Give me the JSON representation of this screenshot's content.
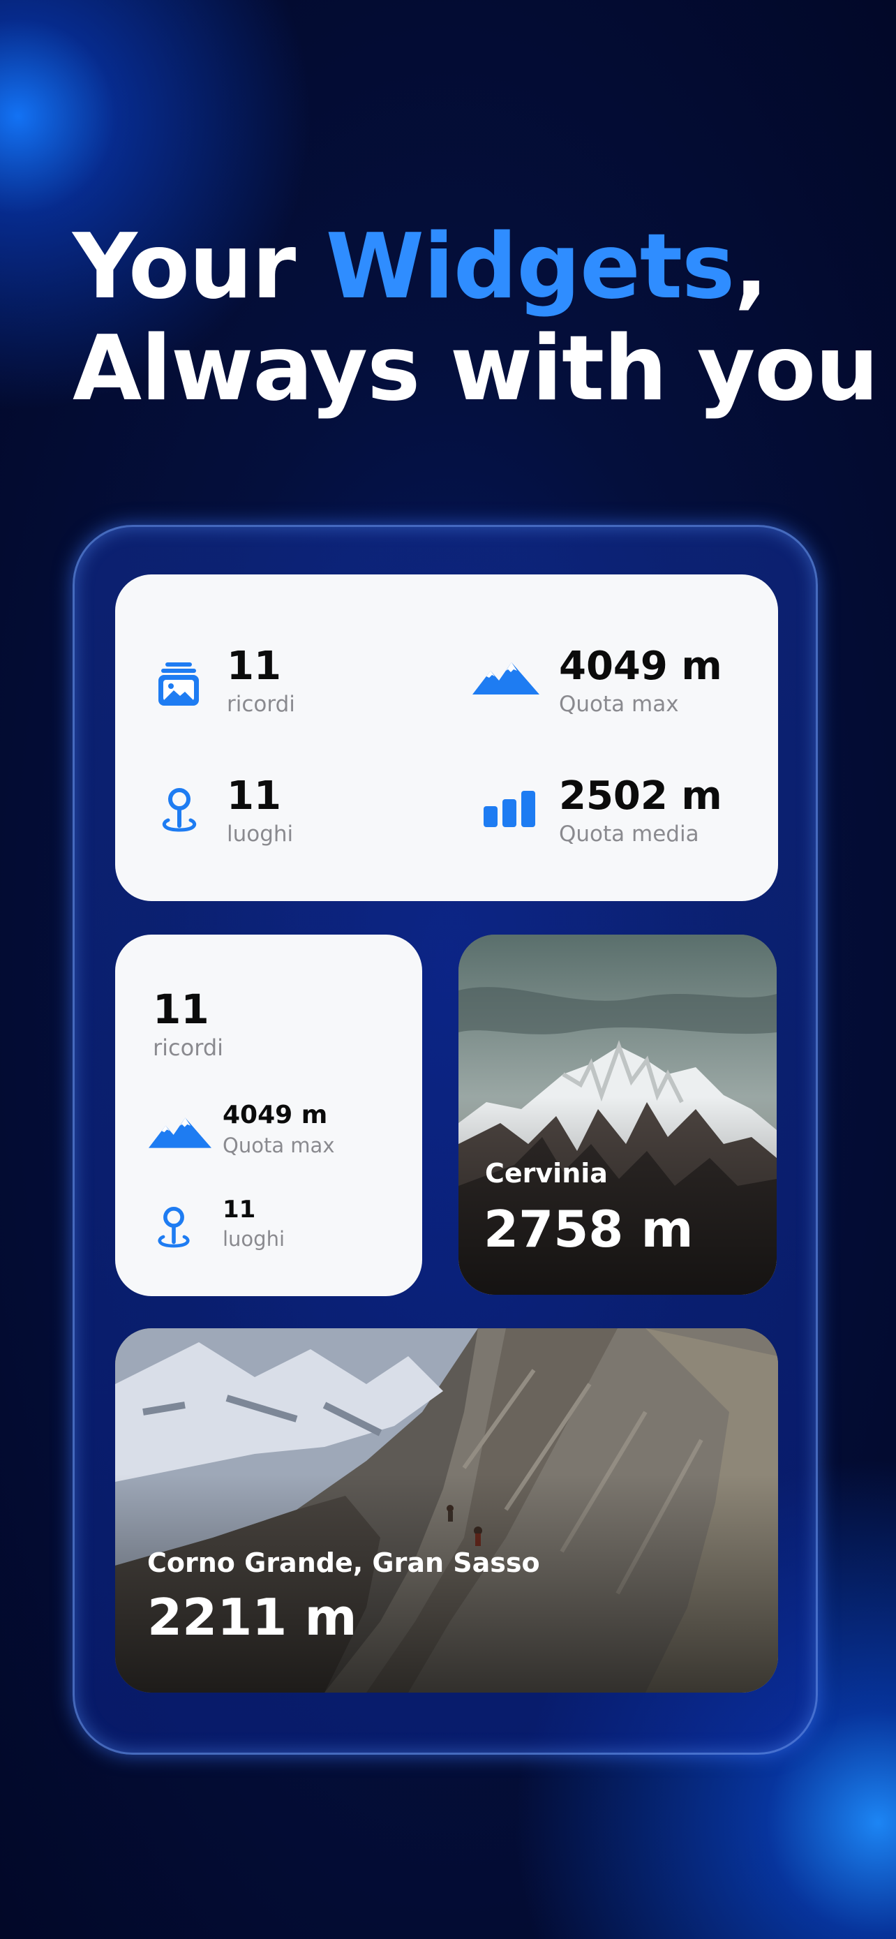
{
  "headline": {
    "line1_pre": "Your ",
    "line1_accent": "Widgets",
    "line1_post": ",",
    "line2": "Always with you"
  },
  "widget_large": {
    "memories": {
      "value": "11",
      "label": "ricordi",
      "icon": "photo-stack-icon"
    },
    "places": {
      "value": "11",
      "label": "luoghi",
      "icon": "map-pin-icon"
    },
    "max_altitude": {
      "value": "4049 m",
      "label": "Quota max",
      "icon": "mountains-icon"
    },
    "avg_altitude": {
      "value": "2502 m",
      "label": "Quota media",
      "icon": "bar-chart-icon"
    }
  },
  "widget_small": {
    "memories": {
      "value": "11",
      "label": "ricordi"
    },
    "max_altitude": {
      "value": "4049 m",
      "label": "Quota max",
      "icon": "mountains-icon"
    },
    "places": {
      "value": "11",
      "label": "luoghi",
      "icon": "map-pin-icon"
    }
  },
  "photo_widget_small": {
    "place": "Cervinia",
    "altitude": "2758 m"
  },
  "photo_widget_wide": {
    "place": "Corno Grande, Gran Sasso",
    "altitude": "2211 m"
  },
  "colors": {
    "accent": "#2f8dff",
    "icon_blue": "#1e7cf2",
    "card_bg": "#f7f8fa"
  }
}
